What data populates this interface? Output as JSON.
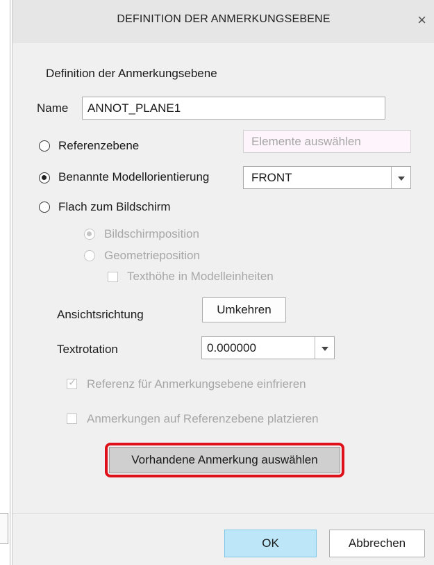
{
  "dialog": {
    "title": "DEFINITION DER ANMERKUNGSEBENE",
    "close_icon": "close-icon",
    "section_label": "Definition der Anmerkungsebene",
    "name_label": "Name",
    "name_value": "ANNOT_PLANE1",
    "options": {
      "reference_plane": {
        "label": "Referenzebene",
        "selected": false,
        "select_placeholder": "Elemente auswählen"
      },
      "named_orientation": {
        "label": "Benannte Modellorientierung",
        "selected": true,
        "value": "FRONT"
      },
      "flat_to_screen": {
        "label": "Flach zum Bildschirm",
        "selected": false,
        "screen_position": "Bildschirmposition",
        "geometry_position": "Geometrieposition",
        "text_height_model_units": "Texthöhe in Modelleinheiten"
      }
    },
    "view_direction_label": "Ansichtsrichtung",
    "flip_button": "Umkehren",
    "text_rotation_label": "Textrotation",
    "text_rotation_value": "0.000000",
    "freeze_reference": "Referenz für Anmerkungsebene einfrieren",
    "place_on_reference": "Anmerkungen auf Referenzebene platzieren",
    "select_existing_button": "Vorhandene Anmerkung auswählen",
    "ok_button": "OK",
    "cancel_button": "Abbrechen"
  },
  "colors": {
    "highlight": "#e0101b",
    "ok_button_bg": "#bde6f8",
    "placeholder_bg": "#fdf5fb"
  }
}
